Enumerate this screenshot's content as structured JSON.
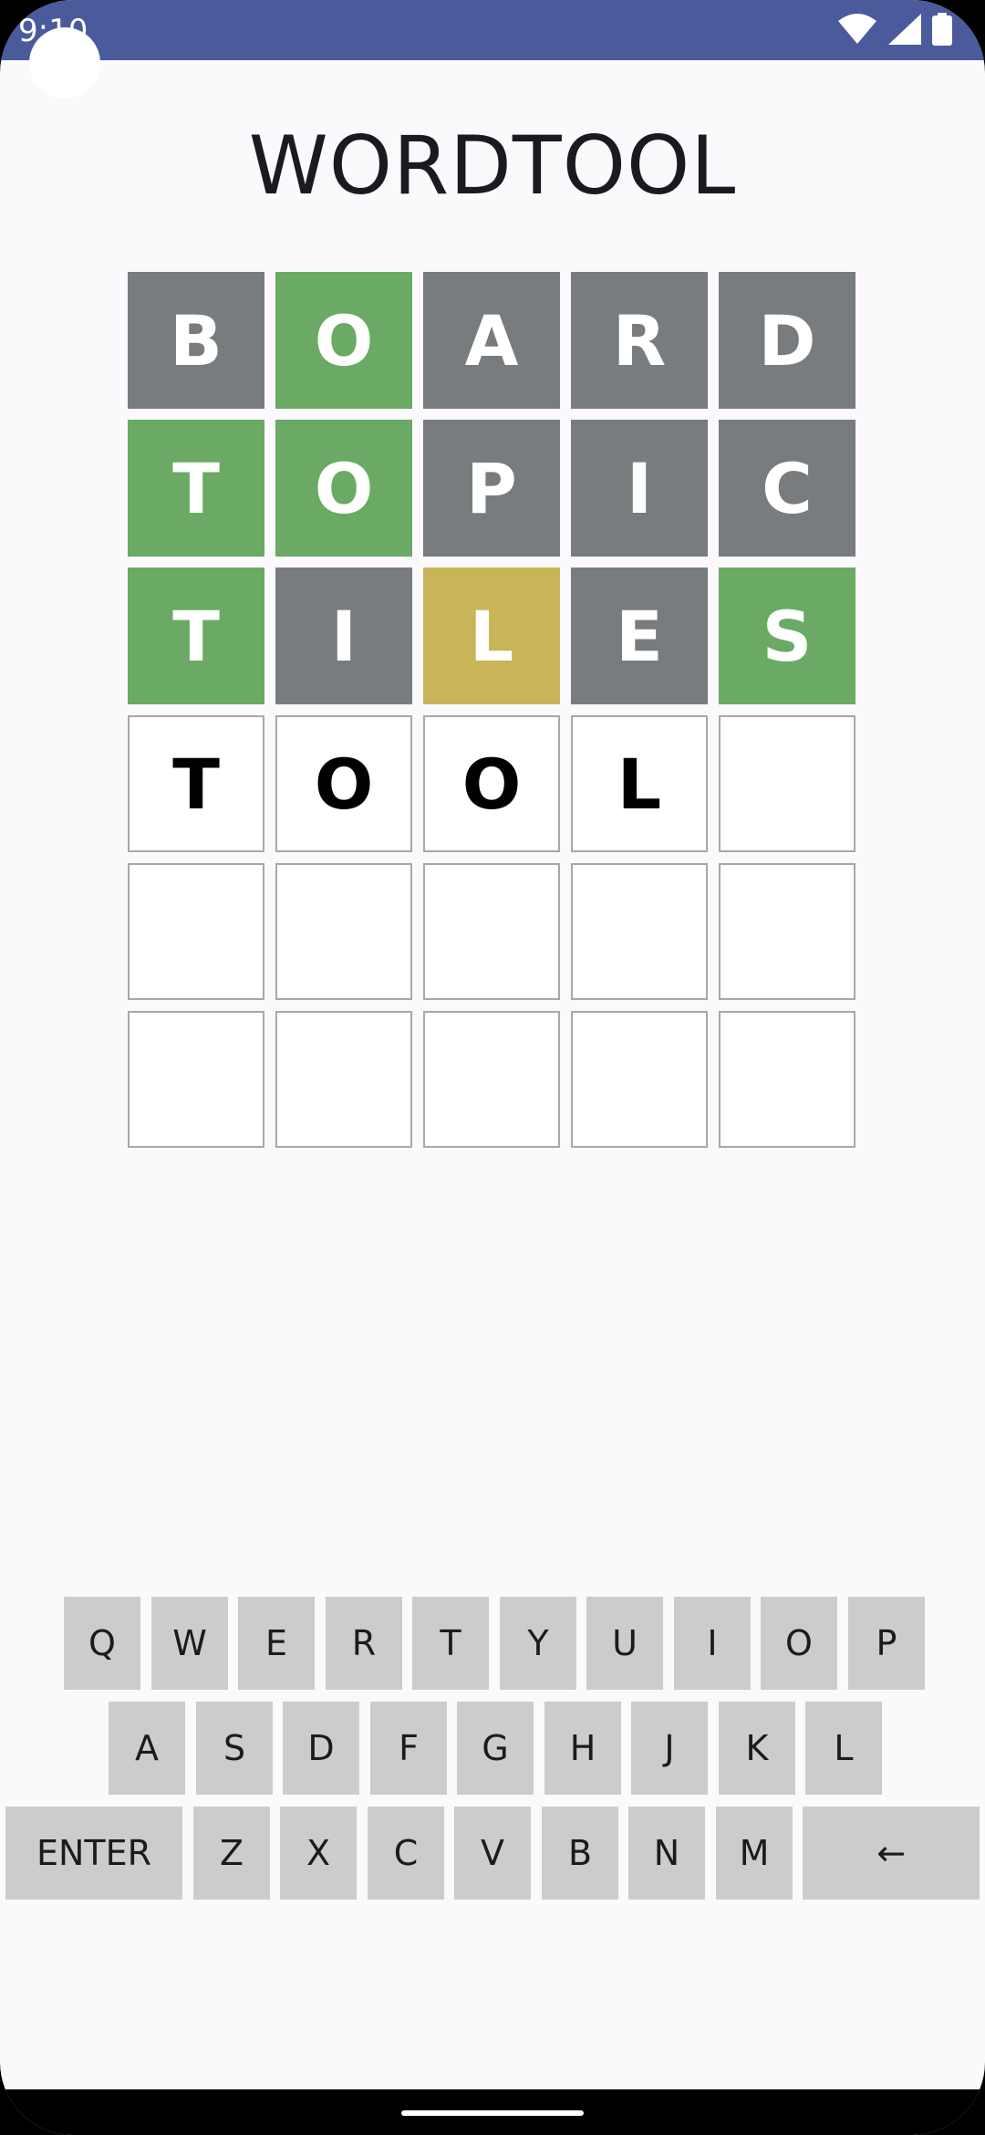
{
  "status_bar": {
    "time": "9:10",
    "icons": [
      "wifi-icon",
      "signal-icon",
      "battery-icon"
    ],
    "background": "#4b5a9a"
  },
  "app": {
    "title": "WORDTOOL"
  },
  "colors": {
    "correct": "#6aaa64",
    "present": "#c9b458",
    "absent": "#787c7e",
    "key": "#cccccc",
    "empty_border": "#a8a8a8"
  },
  "board": {
    "rows": [
      [
        {
          "letter": "B",
          "state": "absent"
        },
        {
          "letter": "O",
          "state": "correct"
        },
        {
          "letter": "A",
          "state": "absent"
        },
        {
          "letter": "R",
          "state": "absent"
        },
        {
          "letter": "D",
          "state": "absent"
        }
      ],
      [
        {
          "letter": "T",
          "state": "correct"
        },
        {
          "letter": "O",
          "state": "correct"
        },
        {
          "letter": "P",
          "state": "absent"
        },
        {
          "letter": "I",
          "state": "absent"
        },
        {
          "letter": "C",
          "state": "absent"
        }
      ],
      [
        {
          "letter": "T",
          "state": "correct"
        },
        {
          "letter": "I",
          "state": "absent"
        },
        {
          "letter": "L",
          "state": "present"
        },
        {
          "letter": "E",
          "state": "absent"
        },
        {
          "letter": "S",
          "state": "correct"
        }
      ],
      [
        {
          "letter": "T",
          "state": "empty"
        },
        {
          "letter": "O",
          "state": "empty"
        },
        {
          "letter": "O",
          "state": "empty"
        },
        {
          "letter": "L",
          "state": "empty"
        },
        {
          "letter": "",
          "state": "empty"
        }
      ],
      [
        {
          "letter": "",
          "state": "empty"
        },
        {
          "letter": "",
          "state": "empty"
        },
        {
          "letter": "",
          "state": "empty"
        },
        {
          "letter": "",
          "state": "empty"
        },
        {
          "letter": "",
          "state": "empty"
        }
      ],
      [
        {
          "letter": "",
          "state": "empty"
        },
        {
          "letter": "",
          "state": "empty"
        },
        {
          "letter": "",
          "state": "empty"
        },
        {
          "letter": "",
          "state": "empty"
        },
        {
          "letter": "",
          "state": "empty"
        }
      ]
    ]
  },
  "keyboard": {
    "rows": [
      [
        "Q",
        "W",
        "E",
        "R",
        "T",
        "Y",
        "U",
        "I",
        "O",
        "P"
      ],
      [
        "A",
        "S",
        "D",
        "F",
        "G",
        "H",
        "J",
        "K",
        "L"
      ],
      [
        "ENTER",
        "Z",
        "X",
        "C",
        "V",
        "B",
        "N",
        "M",
        "←"
      ]
    ]
  }
}
